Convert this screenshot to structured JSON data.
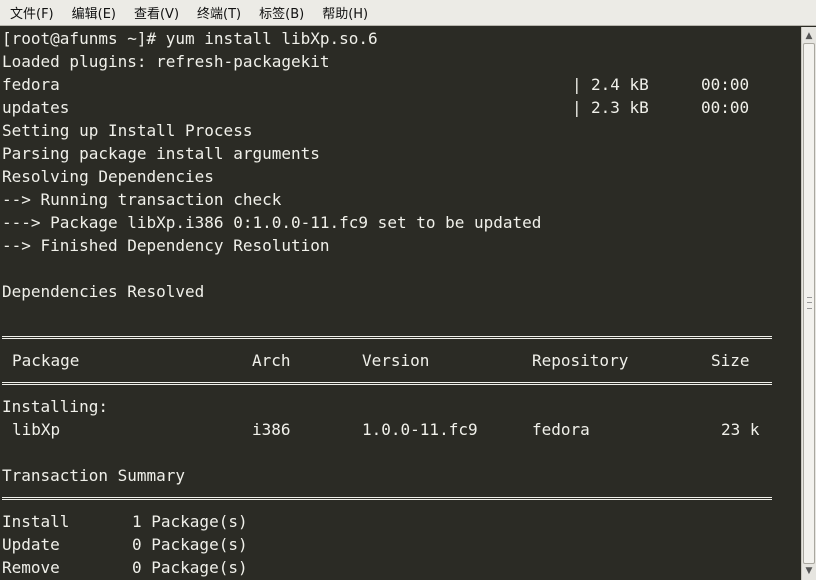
{
  "menubar": {
    "items": [
      "文件(F)",
      "编辑(E)",
      "查看(V)",
      "终端(T)",
      "标签(B)",
      "帮助(H)"
    ]
  },
  "terminal": {
    "prompt": "[root@afunms ~]# yum install libXp.so.6",
    "plugins": "Loaded plugins: refresh-packagekit",
    "repos": [
      {
        "name": "fedora",
        "bar": "|",
        "size": "2.4 kB",
        "time": "00:00"
      },
      {
        "name": "updates",
        "bar": "|",
        "size": "2.3 kB",
        "time": "00:00"
      }
    ],
    "log": [
      "Setting up Install Process",
      "Parsing package install arguments",
      "Resolving Dependencies",
      "--> Running transaction check",
      "---> Package libXp.i386 0:1.0.0-11.fc9 set to be updated",
      "--> Finished Dependency Resolution"
    ],
    "resolved": "Dependencies Resolved",
    "table": {
      "headers": [
        "Package",
        "Arch",
        "Version",
        "Repository",
        "Size"
      ],
      "section": "Installing:",
      "rows": [
        {
          "package": "libXp",
          "arch": "i386",
          "version": "1.0.0-11.fc9",
          "repository": "fedora",
          "size": "23 k"
        }
      ]
    },
    "summary_title": "Transaction Summary",
    "summary": [
      {
        "action": "Install",
        "count": "1 Package(s)"
      },
      {
        "action": "Update",
        "count": "0 Package(s)"
      },
      {
        "action": "Remove",
        "count": "0 Package(s)"
      }
    ]
  }
}
